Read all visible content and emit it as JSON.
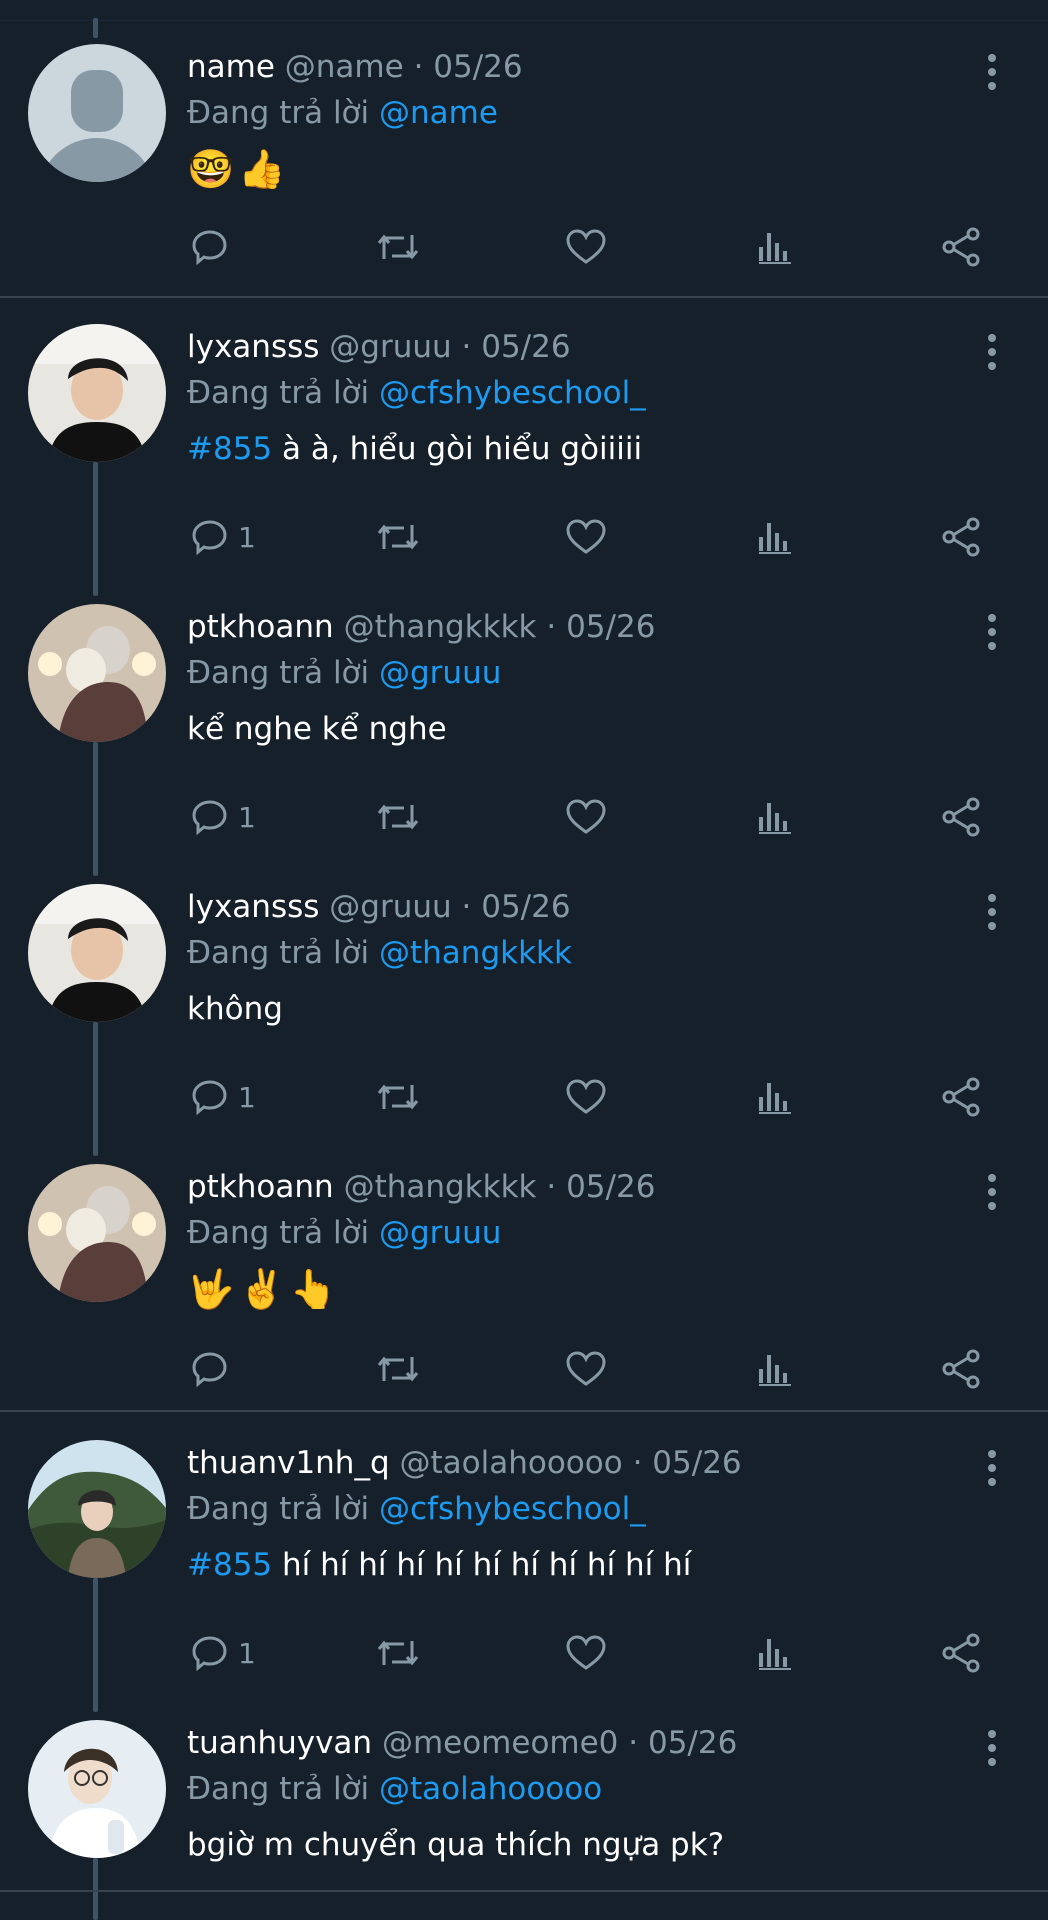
{
  "app": {
    "colors": {
      "background": "#15202b",
      "text": "#ffffff",
      "muted": "#8899a6",
      "accent": "#1d9bf0",
      "divider": "#38444d"
    }
  },
  "tweets": [
    {
      "name": "name",
      "handle": "@name",
      "dot": "·",
      "time": "05/26",
      "reply_prefix": "Đang trả lời",
      "reply_to": "@name",
      "hashtag": "",
      "text": "🤓👍",
      "reply_count": "",
      "avatar": "default-avatar"
    },
    {
      "name": "lyxansss",
      "handle": "@gruuu",
      "dot": "·",
      "time": "05/26",
      "reply_prefix": "Đang trả lời",
      "reply_to": "@cfshybeschool_",
      "hashtag": "#855",
      "text": " à à, hiểu gòi hiểu gòiiiii",
      "reply_count": "1",
      "avatar": "photo-boy-black-shirt"
    },
    {
      "name": "ptkhoann",
      "handle": "@thangkkkk",
      "dot": "·",
      "time": "05/26",
      "reply_prefix": "Đang trả lời",
      "reply_to": "@gruuu",
      "hashtag": "",
      "text": "kể nghe kể nghe",
      "reply_count": "1",
      "avatar": "photo-boy-with-dog"
    },
    {
      "name": "lyxansss",
      "handle": "@gruuu",
      "dot": "·",
      "time": "05/26",
      "reply_prefix": "Đang trả lời",
      "reply_to": "@thangkkkk",
      "hashtag": "",
      "text": "không",
      "reply_count": "1",
      "avatar": "photo-boy-black-shirt"
    },
    {
      "name": "ptkhoann",
      "handle": "@thangkkkk",
      "dot": "·",
      "time": "05/26",
      "reply_prefix": "Đang trả lời",
      "reply_to": "@gruuu",
      "hashtag": "",
      "text": "🤟✌️👆",
      "reply_count": "",
      "avatar": "photo-boy-with-dog"
    },
    {
      "name": "thuanv1nh_q",
      "handle": "@taolahooooo",
      "dot": "·",
      "time": "05/26",
      "reply_prefix": "Đang trả lời",
      "reply_to": "@cfshybeschool_",
      "hashtag": "#855",
      "text": " hí hí hí hí hí hí hí hí hí hí hí",
      "reply_count": "1",
      "avatar": "photo-boy-forest"
    },
    {
      "name": "tuanhuyvan",
      "handle": "@meomeome0",
      "dot": "·",
      "time": "05/26",
      "reply_prefix": "Đang trả lời",
      "reply_to": "@taolahooooo",
      "hashtag": "",
      "text": "bgiờ m chuyển qua thích ngựa pk?",
      "reply_count": "",
      "avatar": "photo-boy-white-shirt"
    }
  ],
  "icons": {
    "reply": "reply-icon",
    "retweet": "retweet-icon",
    "like": "heart-icon",
    "analytics": "analytics-icon",
    "share": "share-icon",
    "more": "more-vertical-icon"
  }
}
